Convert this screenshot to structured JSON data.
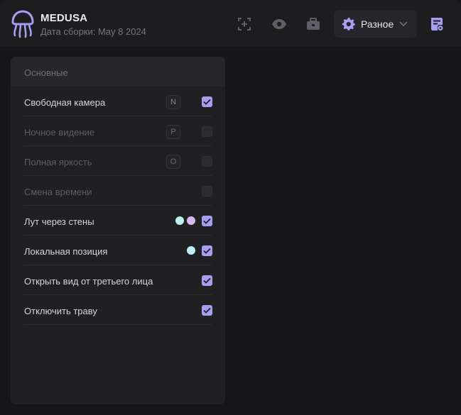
{
  "header": {
    "app_name": "MEDUSA",
    "build_date": "Дата сборки: May 8 2024",
    "logo_icon": "jellyfish-logo-icon",
    "buttons": [
      "crosshair-focus-icon",
      "eye-icon",
      "briefcase-icon",
      "settings-gear-icon",
      "script-list-icon"
    ],
    "dropdown_label": "Разное"
  },
  "colors": {
    "accent": "#a89ef0",
    "dot_cyan": "#bdeef0",
    "dot_purple": "#d9b6f0"
  },
  "panel": {
    "title": "Основные",
    "rows": [
      {
        "label": "Свободная камера",
        "key": "N",
        "checked": true,
        "disabled": false
      },
      {
        "label": "Ночное видение",
        "key": "P",
        "checked": false,
        "disabled": true
      },
      {
        "label": "Полная яркость",
        "key": "O",
        "checked": false,
        "disabled": true
      },
      {
        "label": "Смена времени",
        "key": "",
        "checked": false,
        "disabled": true
      },
      {
        "label": "Лут через стены",
        "key": "",
        "checked": true,
        "disabled": false,
        "colors": [
          "#bdeef0",
          "#d9b6f0"
        ]
      },
      {
        "label": "Локальная позиция",
        "key": "",
        "checked": true,
        "disabled": false,
        "colors": [
          "#bdeef0"
        ]
      },
      {
        "label": "Открыть вид от третьего лица",
        "key": "",
        "checked": true,
        "disabled": false
      },
      {
        "label": "Отключить траву",
        "key": "",
        "checked": true,
        "disabled": false
      }
    ]
  }
}
